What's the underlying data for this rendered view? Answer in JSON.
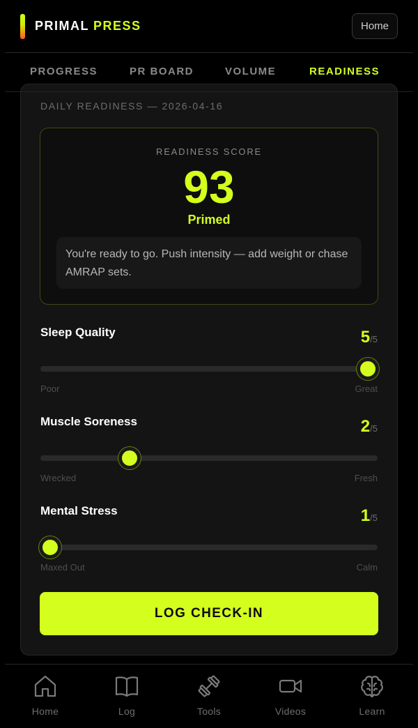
{
  "header": {
    "brand_word1": "PRIMAL",
    "brand_word2": "PRESS",
    "home_button": "Home"
  },
  "tabs": [
    {
      "label": "PROGRESS",
      "active": false
    },
    {
      "label": "PR BOARD",
      "active": false
    },
    {
      "label": "VOLUME",
      "active": false
    },
    {
      "label": "READINESS",
      "active": true
    }
  ],
  "readiness": {
    "date_label": "DAILY READINESS — 2026-04-16",
    "score_label": "READINESS SCORE",
    "score": "93",
    "status": "Primed",
    "advice": "You're ready to go. Push intensity — add weight or chase AMRAP sets."
  },
  "metrics": [
    {
      "name": "Sleep Quality",
      "value": "5",
      "max": "/5",
      "min_label": "Poor",
      "max_label": "Great",
      "level": 1.0
    },
    {
      "name": "Muscle Soreness",
      "value": "2",
      "max": "/5",
      "min_label": "Wrecked",
      "max_label": "Fresh",
      "level": 0.25
    },
    {
      "name": "Mental Stress",
      "value": "1",
      "max": "/5",
      "min_label": "Maxed Out",
      "max_label": "Calm",
      "level": 0.0
    }
  ],
  "cta_label": "LOG CHECK-IN",
  "bottom_nav": [
    {
      "label": "Home",
      "icon": "home-icon"
    },
    {
      "label": "Log",
      "icon": "book-icon"
    },
    {
      "label": "Tools",
      "icon": "dumbbell-icon"
    },
    {
      "label": "Videos",
      "icon": "video-camera-icon"
    },
    {
      "label": "Learn",
      "icon": "brain-icon"
    }
  ],
  "colors": {
    "accent": "#d4ff1e",
    "background": "#000000",
    "card": "#141414"
  }
}
